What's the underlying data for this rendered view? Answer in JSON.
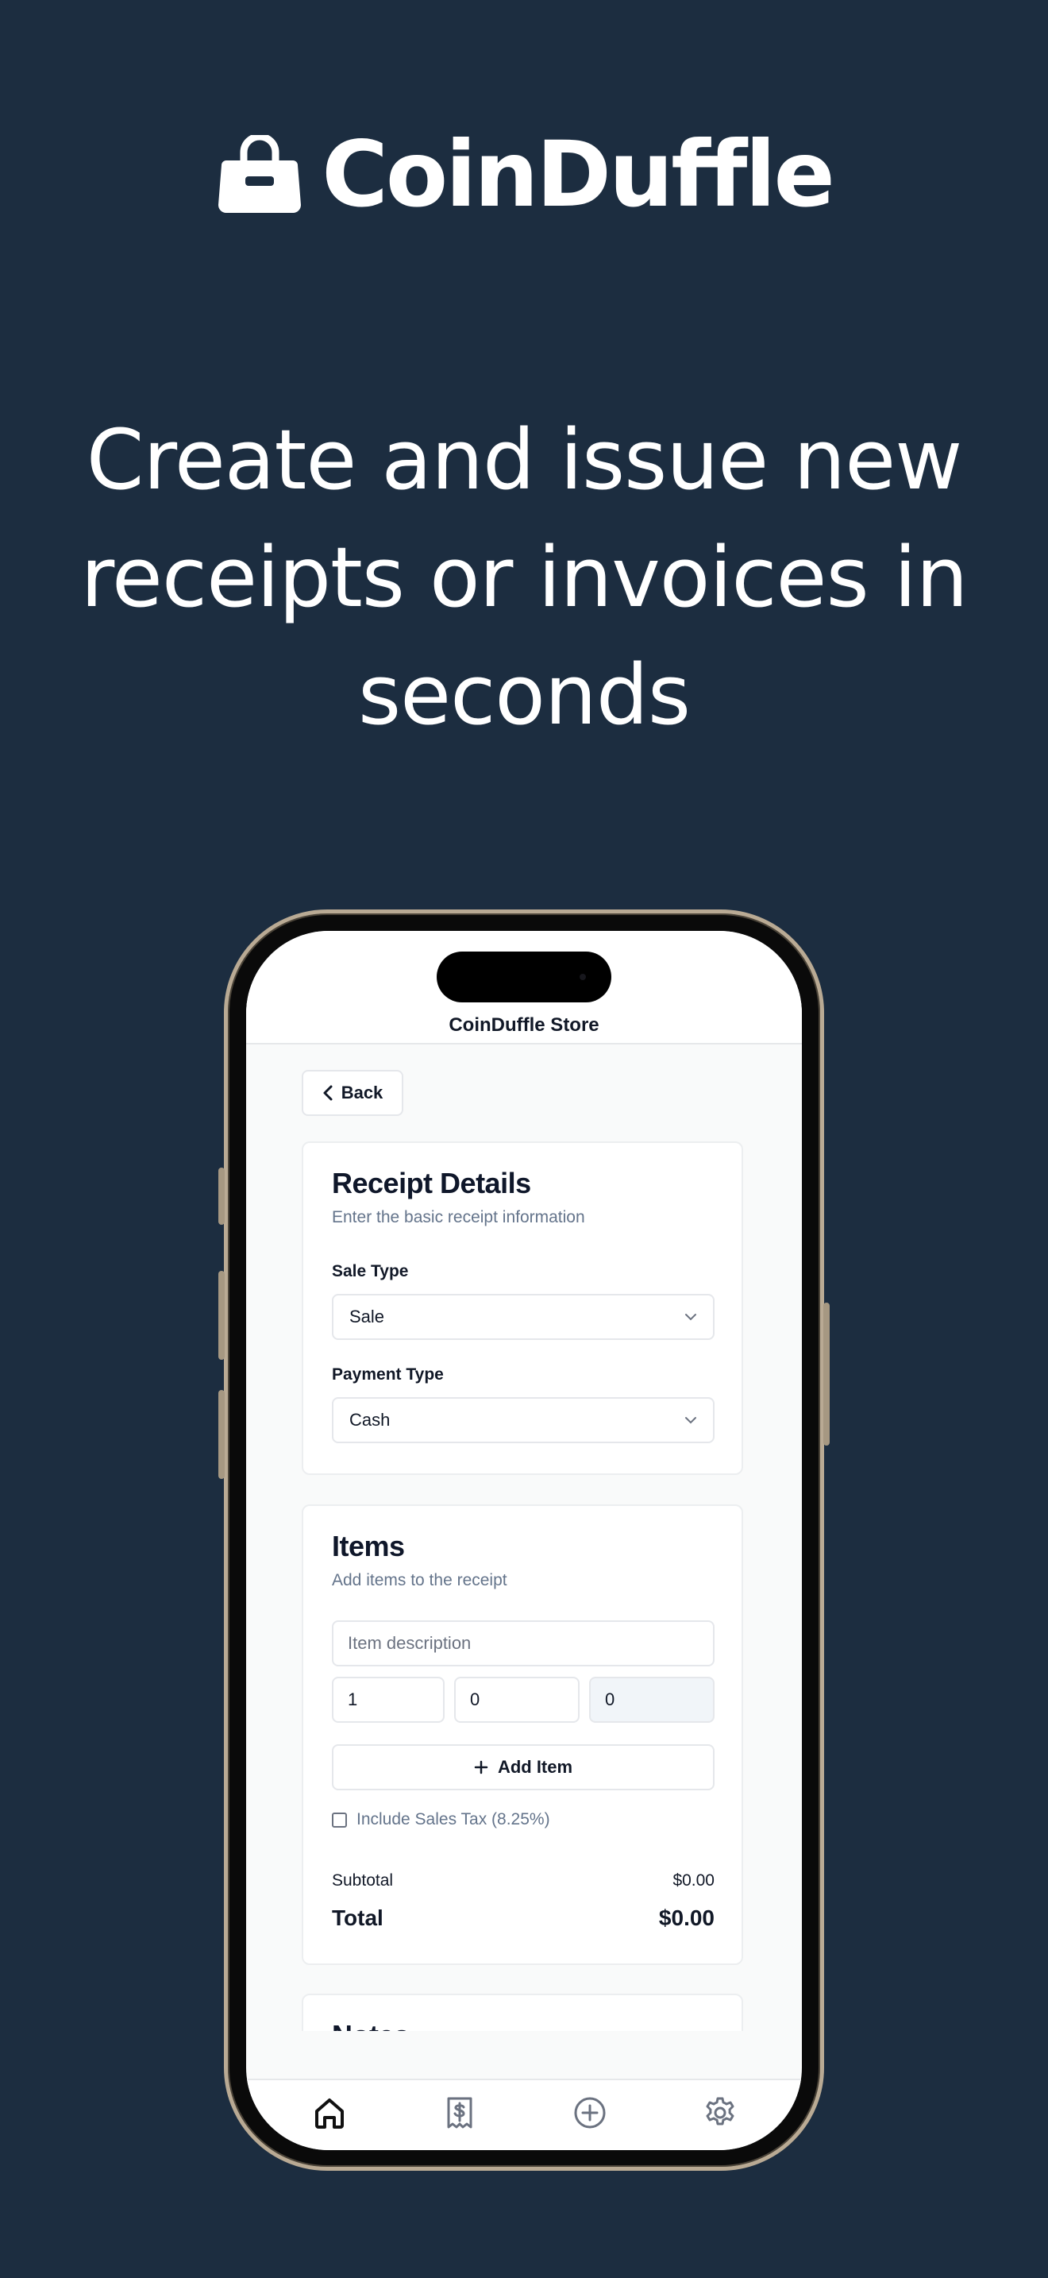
{
  "brand": {
    "name": "CoinDuffle"
  },
  "headline": "Create and issue new receipts or invoices in seconds",
  "app": {
    "store_title": "CoinDuffle Store",
    "back_label": "Back",
    "receipt_details": {
      "title": "Receipt Details",
      "subtitle": "Enter the basic receipt information",
      "sale_type_label": "Sale Type",
      "sale_type_value": "Sale",
      "payment_type_label": "Payment Type",
      "payment_type_value": "Cash"
    },
    "items": {
      "title": "Items",
      "subtitle": "Add items to the receipt",
      "description_placeholder": "Item description",
      "quantity_value": "1",
      "price_value": "0",
      "line_total_value": "0",
      "add_item_label": "Add Item",
      "sales_tax_label": "Include Sales Tax (8.25%)",
      "sales_tax_checked": false,
      "subtotal_label": "Subtotal",
      "subtotal_value": "$0.00",
      "total_label": "Total",
      "total_value": "$0.00"
    },
    "notes": {
      "title": "Notes"
    },
    "tabs": [
      {
        "icon": "home-icon",
        "active": true
      },
      {
        "icon": "receipt-dollar-icon",
        "active": false
      },
      {
        "icon": "plus-circle-icon",
        "active": false
      },
      {
        "icon": "gear-icon",
        "active": false
      }
    ]
  },
  "colors": {
    "background": "#1c2d40",
    "screen_bg": "#f9fafa",
    "text_primary": "#0f172a",
    "text_muted": "#64748b",
    "border": "#e5e7eb"
  }
}
